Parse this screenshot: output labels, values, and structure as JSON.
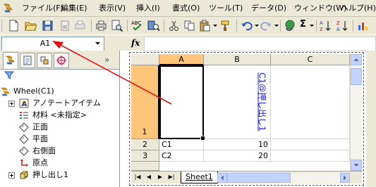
{
  "menu": {
    "items": [
      "ファイル(F)",
      "編集(E)",
      "表示(V)",
      "挿入(I)",
      "書式(O)",
      "ツール(T)",
      "データ(D)",
      "ウィンドウ(W)",
      "ヘルプ(H)"
    ]
  },
  "toolbar": {
    "icons": [
      "new-icon",
      "open-icon",
      "save-icon",
      "permission-icon",
      "print-icon",
      "print-preview-icon",
      "spelling-icon",
      "research-icon",
      "cut-icon",
      "copy-icon",
      "paste-icon",
      "format-painter-icon",
      "undo-icon",
      "redo-icon",
      "hyperlink-icon",
      "autosum-icon",
      "sort-ascending-icon",
      "sort-descending-icon"
    ],
    "autosum_label": "Σ"
  },
  "namebox": {
    "value": "A1"
  },
  "formula_bar": {
    "fx_label": "fx",
    "value": ""
  },
  "panel": {
    "collapse_label": "»",
    "tree": [
      {
        "label": "Wheel(C1)",
        "icon": "part-icon",
        "expandable": false
      },
      {
        "label": "アノテートアイテム",
        "icon": "annotation-icon",
        "expandable": true
      },
      {
        "label": "材料 <未指定>",
        "icon": "material-icon",
        "expandable": false
      },
      {
        "label": "正面",
        "icon": "plane-icon",
        "expandable": false
      },
      {
        "label": "平面",
        "icon": "plane-icon",
        "expandable": false
      },
      {
        "label": "右側面",
        "icon": "plane-icon",
        "expandable": false
      },
      {
        "label": "原点",
        "icon": "origin-icon",
        "expandable": false
      },
      {
        "label": "押し出し1",
        "icon": "extrude-icon",
        "expandable": true
      }
    ]
  },
  "sheet": {
    "columns": [
      "A",
      "B",
      "C"
    ],
    "rows": [
      {
        "num": "1",
        "a": "",
        "b": "C1@押し出し1",
        "c": ""
      },
      {
        "num": "2",
        "a": "C1",
        "b": "10",
        "c": ""
      },
      {
        "num": "3",
        "a": "C2",
        "b": "20",
        "c": ""
      }
    ],
    "tab": "Sheet1",
    "nav": [
      "|◀",
      "◀",
      "▶",
      "▶|"
    ]
  },
  "colors": {
    "chrome": "#ece9d8",
    "selected_header": "#ffc57a",
    "link_blue": "#1a1ad8",
    "arrow_red": "#e01010"
  }
}
